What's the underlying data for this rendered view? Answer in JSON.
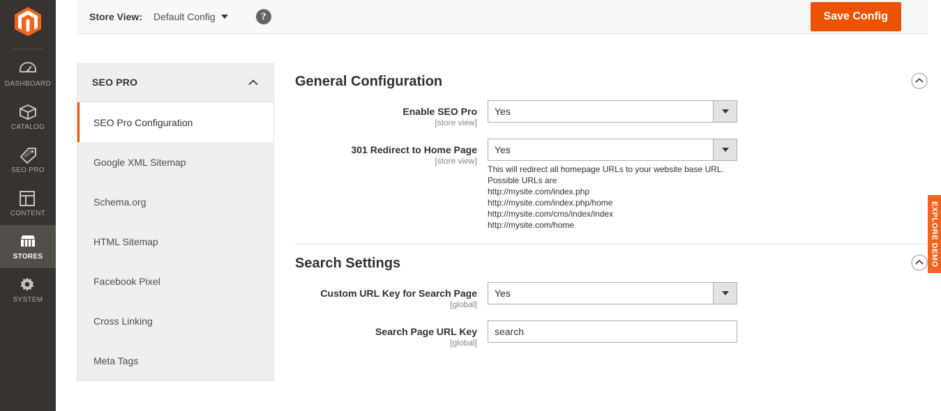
{
  "admin_nav": {
    "logo": "magento-logo",
    "items": [
      {
        "label": "DASHBOARD",
        "icon": "dashboard-icon",
        "active": false
      },
      {
        "label": "CATALOG",
        "icon": "catalog-box-icon",
        "active": false
      },
      {
        "label": "SEO PRO",
        "icon": "seo-tag-icon",
        "active": false
      },
      {
        "label": "CONTENT",
        "icon": "content-layout-icon",
        "active": false
      },
      {
        "label": "STORES",
        "icon": "stores-shop-icon",
        "active": true
      },
      {
        "label": "SYSTEM",
        "icon": "system-gear-icon",
        "active": false
      }
    ]
  },
  "header": {
    "store_view_label": "Store View:",
    "store_view_value": "Default Config",
    "help_icon": "question-mark-icon",
    "save_label": "Save Config"
  },
  "config_nav": {
    "title": "SEO PRO",
    "collapse_icon": "chevron-up-icon",
    "items": [
      {
        "label": "SEO Pro Configuration",
        "active": true
      },
      {
        "label": "Google XML Sitemap",
        "active": false
      },
      {
        "label": "Schema.org",
        "active": false
      },
      {
        "label": "HTML Sitemap",
        "active": false
      },
      {
        "label": "Facebook Pixel",
        "active": false
      },
      {
        "label": "Cross Linking",
        "active": false
      },
      {
        "label": "Meta Tags",
        "active": false
      }
    ]
  },
  "sections": {
    "general": {
      "title": "General Configuration",
      "collapse_icon": "circle-chevron-up-icon",
      "enable_seo_pro": {
        "label": "Enable SEO Pro",
        "scope": "[store view]",
        "value": "Yes"
      },
      "redirect_home": {
        "label": "301 Redirect to Home Page",
        "scope": "[store view]",
        "value": "Yes",
        "helper_lines": [
          "This will redirect all homepage URLs to your website base URL.",
          "Possible URLs are",
          "http://mysite.com/index.php",
          "http://mysite.com/index.php/home",
          "http://mysite.com/cms/index/index",
          "http://mysite.com/home"
        ]
      }
    },
    "search": {
      "title": "Search Settings",
      "collapse_icon": "circle-chevron-up-icon",
      "custom_url_key": {
        "label": "Custom URL Key for Search Page",
        "scope": "[global]",
        "value": "Yes"
      },
      "search_url_key": {
        "label": "Search Page URL Key",
        "scope": "[global]",
        "value": "search"
      }
    }
  },
  "explore_demo": {
    "label": "EXPLORE DEMO"
  },
  "colors": {
    "brand_orange": "#eb5202",
    "demo_orange": "#f4631e",
    "nav_dark": "#373330",
    "nav_active": "#524e49"
  }
}
